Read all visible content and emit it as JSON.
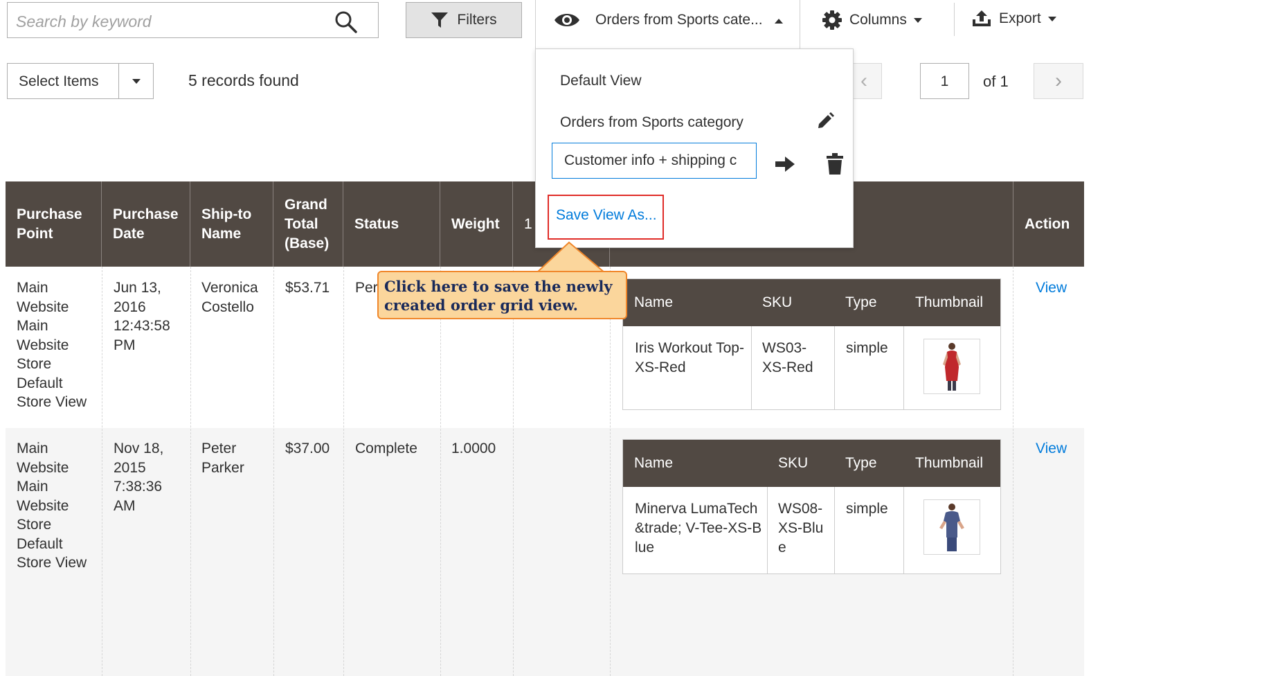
{
  "toolbar": {
    "search_placeholder": "Search by keyword",
    "filters_label": "Filters",
    "current_view_label": "Orders from Sports cate...",
    "columns_label": "Columns",
    "export_label": "Export"
  },
  "mass_actions": {
    "select_label": "Select Items",
    "records_found": "5 records found"
  },
  "pagination": {
    "prev": "‹",
    "current_page": "1",
    "of_label": "of 1",
    "next": "›"
  },
  "views_dropdown": {
    "default_view": "Default View",
    "sports_view": "Orders from Sports category",
    "new_view_input": "Customer info + shipping c",
    "save_view_as": "Save View As..."
  },
  "callout": {
    "text": "Click here to save the newly created order grid view."
  },
  "columns": {
    "purchase_point": "Purchase Point",
    "purchase_date": "Purchase Date",
    "ship_to_name": "Ship-to Name",
    "grand_total": "Grand Total (Base)",
    "status": "Status",
    "weight": "Weight",
    "partial": "1",
    "action": "Action"
  },
  "rows": [
    {
      "purchase_point": "Main Website\n  Main Website Store\n     Default Store View",
      "purchase_date": "Jun 13, 2016 12:43:58 PM",
      "ship_to_name": "Veronica Costello",
      "grand_total": "$53.71",
      "status": "Per",
      "weight": "",
      "action": "View",
      "items": {
        "headers": [
          "Name",
          "SKU",
          "Type",
          "Thumbnail"
        ],
        "name": "Iris Workout Top-XS-Red",
        "sku": "WS03-XS-Red",
        "type": "simple"
      }
    },
    {
      "purchase_point": "Main Website\n  Main Website Store\n     Default Store View",
      "purchase_date": "Nov 18, 2015 7:38:36 AM",
      "ship_to_name": "Peter Parker",
      "grand_total": "$37.00",
      "status": "Complete",
      "weight": "1.0000",
      "action": "View",
      "items": {
        "headers": [
          "Name",
          "SKU",
          "Type",
          "Thumbnail"
        ],
        "name": "Minerva LumaTech&trade; V-Tee-XS-Blue",
        "sku": "WS08-XS-Blue",
        "type": "simple"
      }
    }
  ],
  "colors": {
    "header_bg": "#514943",
    "link": "#007bdb",
    "highlight_border": "#e02b27",
    "callout_bg": "#fbd69c",
    "callout_border": "#f0872b"
  },
  "icons": [
    "search-icon",
    "filter-icon",
    "eye-icon",
    "gear-icon",
    "export-icon",
    "pencil-icon",
    "arrow-right-icon",
    "trash-icon"
  ]
}
